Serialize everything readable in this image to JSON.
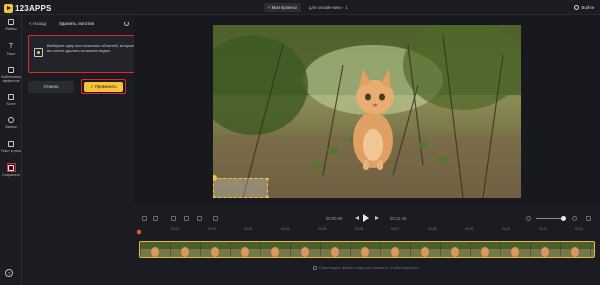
{
  "app": {
    "logo_text": "123APPS"
  },
  "header": {
    "projects_label": "< Мои проекты",
    "project_title": "для онлайн-кино - 1",
    "login_label": "Войти"
  },
  "rail": {
    "items": [
      {
        "label": "Файлы",
        "icon": "folder-icon"
      },
      {
        "label": "Текст",
        "icon": "text-icon"
      },
      {
        "label": "Библиотека эффектов",
        "icon": "library-icon"
      },
      {
        "label": "Холст",
        "icon": "canvas-icon"
      },
      {
        "label": "Запись",
        "icon": "record-icon"
      },
      {
        "label": "Текст в речь",
        "icon": "tts-icon"
      },
      {
        "label": "Сохранить",
        "icon": "download-icon"
      }
    ],
    "help_label": "?"
  },
  "panel": {
    "back_label": "<  Назад",
    "title": "Удалить логотип",
    "hint": "Выберите одну или несколько областей, которые вы хотите удалить из вашего видео.",
    "cancel_label": "Отмена",
    "apply_label": "✓ Применить"
  },
  "player": {
    "current_time": "00:00.00",
    "duration": "00:12.43"
  },
  "timeline": {
    "ticks": [
      "00:01",
      "00:02",
      "00:03",
      "00:04",
      "00:05",
      "00:06",
      "00:07",
      "00:08",
      "00:09",
      "00:10",
      "00:11",
      "00:12"
    ],
    "drop_hint": "Перетащите файлы сюда или нажмите, чтобы загрузить"
  },
  "colors": {
    "accent": "#f5c23b",
    "highlight_red": "#e02828",
    "bg": "#1b1c21"
  }
}
